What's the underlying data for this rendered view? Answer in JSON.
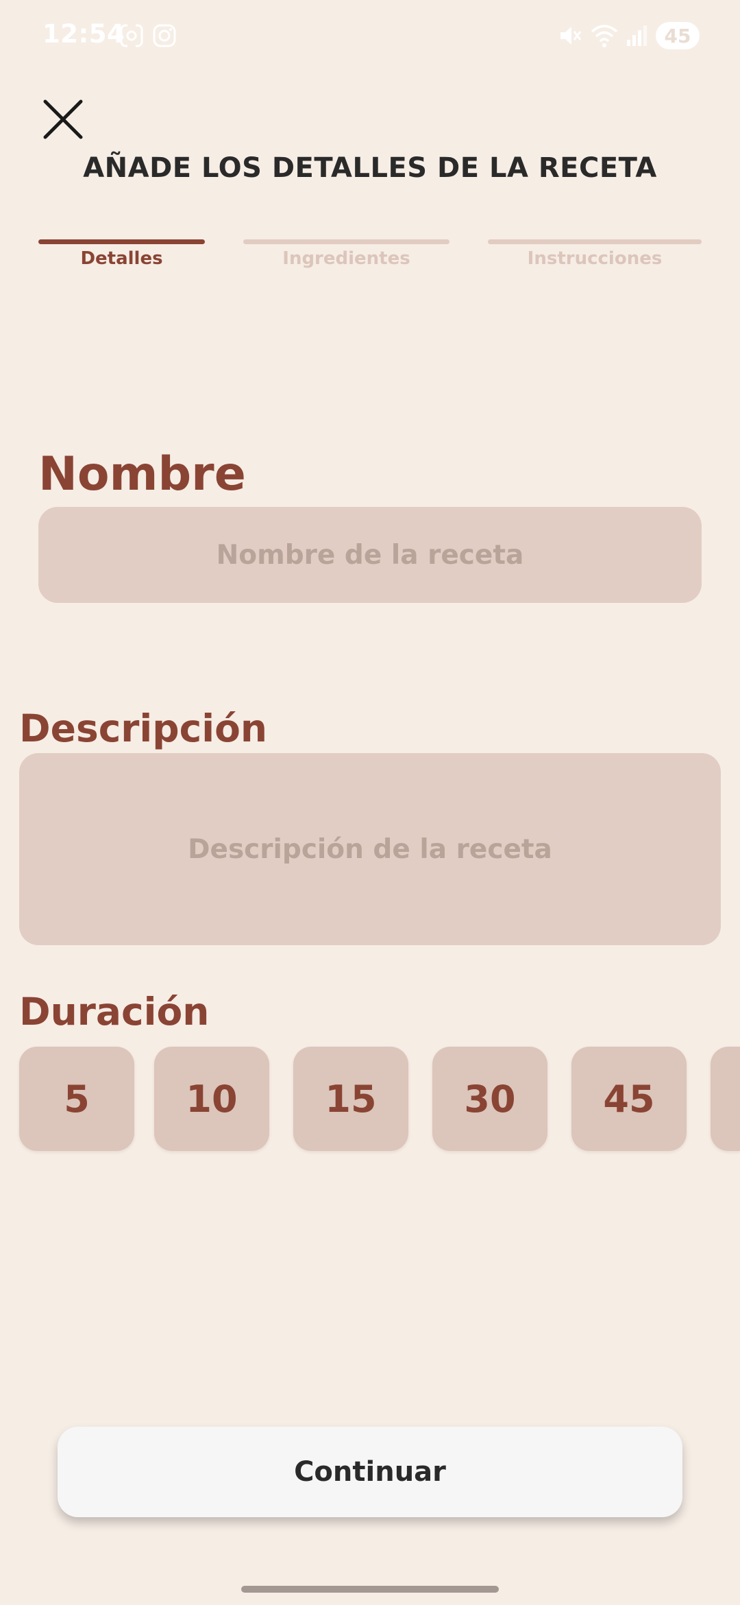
{
  "status_bar": {
    "time": "12:54",
    "battery": "45",
    "icons": [
      "screenshot-icon",
      "instagram-icon",
      "mute-icon",
      "wifi-icon",
      "signal-icon"
    ]
  },
  "header": {
    "close_icon": "close-icon",
    "title": "AÑADE LOS DETALLES DE LA RECETA"
  },
  "steps": [
    {
      "label": "Detalles",
      "active": true
    },
    {
      "label": "Ingredientes",
      "active": false
    },
    {
      "label": "Instrucciones",
      "active": false
    }
  ],
  "form": {
    "name": {
      "label": "Nombre",
      "placeholder": "Nombre de la receta"
    },
    "description": {
      "label": "Descripción",
      "placeholder": "Descripción de la receta"
    },
    "duration": {
      "label": "Duración",
      "options": [
        "5",
        "10",
        "15",
        "30",
        "45"
      ]
    }
  },
  "footer": {
    "continue_label": "Continuar"
  },
  "colors": {
    "background": "#f6ede5",
    "accent": "#8a4434",
    "field": "#e1cdc3",
    "step_inactive": "#e2ccc2"
  }
}
